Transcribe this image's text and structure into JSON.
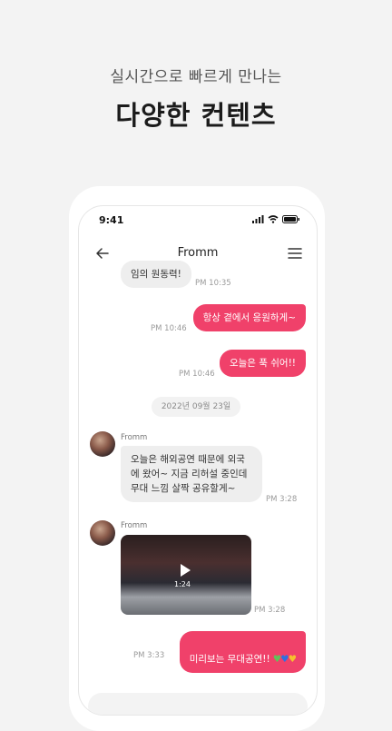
{
  "promo": {
    "subtitle": "실시간으로 빠르게 만나는",
    "title": "다양한 컨텐츠"
  },
  "status_bar": {
    "time": "9:41"
  },
  "header": {
    "title": "Fromm"
  },
  "messages": [
    {
      "text": "임의 원동력!",
      "time": "PM 10:35"
    },
    {
      "text": "항상 곁에서 응원하게~",
      "time": "PM 10:46"
    },
    {
      "text": "오늘은 푹 쉬어!!",
      "time": "PM 10:46"
    },
    {
      "text": "오늘은 해외공연 때문에 외국\n에 왔어~ 지금 리허설 중인데\n무대 느낌 살짝 공유할게~",
      "time": "PM 3:28",
      "sender": "Fromm"
    },
    {
      "duration": "1:24",
      "time": "PM 3:28",
      "sender": "Fromm"
    },
    {
      "text": "미리보는 무대공연!!",
      "emoji": "💚💙💛",
      "time": "PM 3:33"
    }
  ],
  "date_divider": "2022년 09월 23일",
  "colors": {
    "accent": "#f0416a",
    "incoming_bubble": "#eeeeee"
  },
  "icons": {
    "back": "arrow-left-icon",
    "menu": "hamburger-menu-icon",
    "play": "play-icon",
    "signal": "signal-icon",
    "wifi": "wifi-icon",
    "battery": "battery-icon"
  }
}
